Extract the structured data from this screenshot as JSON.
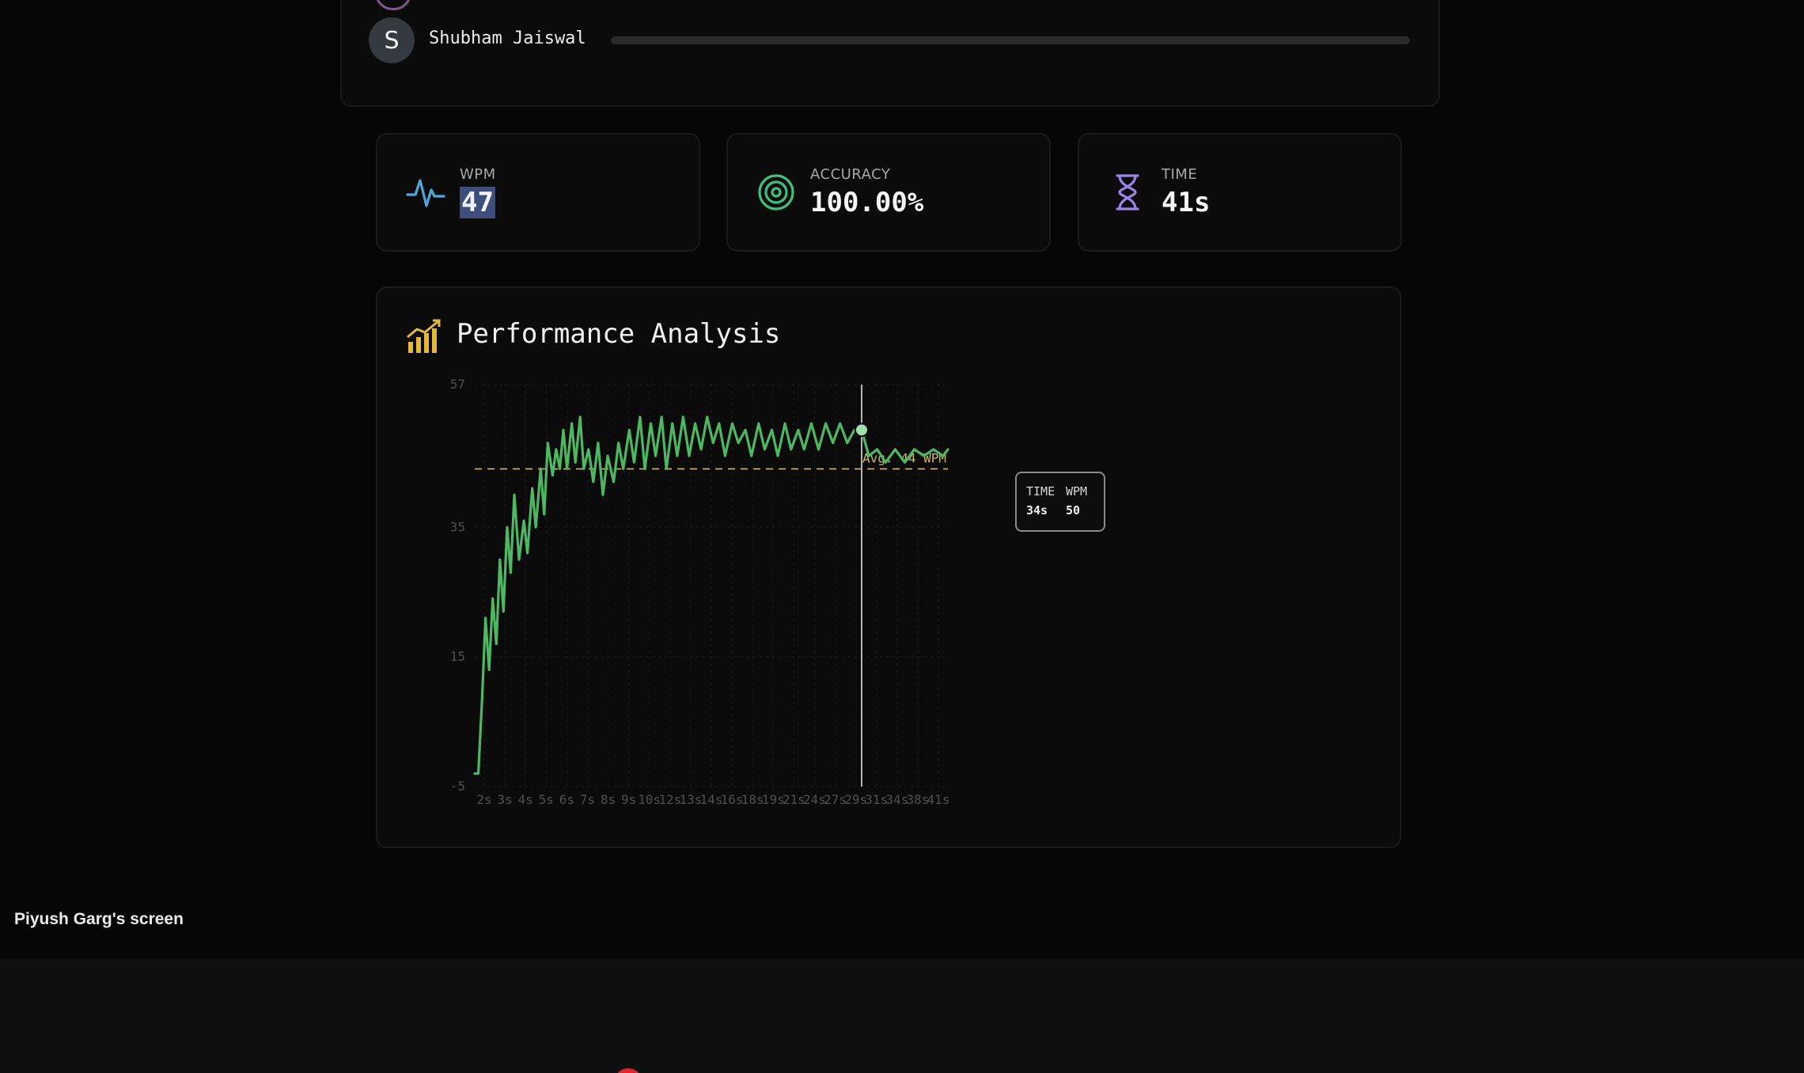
{
  "race": {
    "player_initial": "S",
    "player_name": "Shubham Jaiswal",
    "progress": 0
  },
  "stats": {
    "wpm": {
      "label": "WPM",
      "value": "47",
      "icon": "pulse-icon",
      "color": "#4fa6d9"
    },
    "accuracy": {
      "label": "ACCURACY",
      "value": "100.00%",
      "icon": "target-icon",
      "color": "#3fbf7a"
    },
    "time": {
      "label": "TIME",
      "value": "41s",
      "icon": "hourglass-icon",
      "color": "#9a86e8"
    }
  },
  "performance": {
    "title": "Performance Analysis",
    "icon": "bar-chart-icon",
    "accent": "#e2b93b"
  },
  "chart_data": {
    "type": "line",
    "series": [
      {
        "color": "#4db861",
        "x": [
          1.7,
          2.0,
          2.3,
          2.6,
          2.9,
          3.2,
          3.5,
          3.8,
          4.1,
          4.4,
          4.7,
          5.0,
          5.4,
          5.8,
          6.1,
          6.5,
          6.8,
          7.2,
          7.5,
          7.8,
          8.2,
          8.5,
          8.8,
          9.1,
          9.4,
          9.8,
          10.1,
          10.5,
          10.8,
          11.2,
          11.6,
          12.0,
          12.4,
          12.8,
          13.3,
          13.7,
          14.1,
          14.6,
          15.0,
          15.5,
          15.9,
          16.4,
          16.8,
          17.3,
          17.7,
          18.2,
          18.6,
          19.1,
          19.6,
          20.1,
          20.6,
          21.1,
          21.6,
          22.1,
          22.6,
          23.2,
          23.7,
          24.3,
          24.8,
          25.4,
          25.9,
          26.5,
          27.0,
          27.6,
          28.1,
          28.7,
          29.2,
          29.8,
          30.4,
          31.0,
          31.6,
          32.2,
          32.8,
          33.4,
          34.0,
          34.6,
          35.3,
          36.0,
          36.8,
          37.6,
          38.4,
          39.2,
          40.0,
          40.8,
          41.2
        ],
        "y": [
          -3,
          -3,
          8,
          21,
          13,
          24,
          17,
          30,
          22,
          35,
          28,
          40,
          30,
          36,
          31,
          41,
          35,
          44,
          37,
          48,
          43,
          47,
          44,
          50,
          44,
          51,
          45,
          52,
          44,
          47,
          42,
          48,
          40,
          46,
          42,
          48,
          44,
          50,
          45,
          52,
          44,
          51,
          46,
          52,
          44,
          51,
          46,
          52,
          46,
          51,
          47,
          52,
          48,
          51,
          46,
          51,
          48,
          50,
          46,
          51,
          47,
          50,
          46,
          51,
          47,
          50,
          47,
          51,
          47,
          51,
          48,
          51,
          48,
          50,
          50,
          46,
          47,
          45,
          47,
          45,
          47,
          46,
          47,
          46,
          47
        ]
      }
    ],
    "xlim": [
      1.7,
      41.2
    ],
    "ylim": [
      -5,
      57
    ],
    "yticks": [
      57,
      35,
      15,
      -5
    ],
    "xticks": [
      "2s",
      "3s",
      "4s",
      "5s",
      "6s",
      "7s",
      "8s",
      "9s",
      "10s",
      "12s",
      "13s",
      "14s",
      "16s",
      "18s",
      "19s",
      "21s",
      "24s",
      "27s",
      "29s",
      "31s",
      "34s",
      "38s",
      "41s"
    ],
    "average": {
      "value": 44,
      "label": "Avg: 44 WPM",
      "color": "#c8b86a"
    },
    "highlight": {
      "x": 34,
      "y": 50,
      "time": "34s",
      "wpm": "50"
    },
    "tooltip": {
      "time_header": "TIME",
      "wpm_header": "WPM"
    }
  },
  "screen_share": {
    "label": "Piyush Garg's screen"
  }
}
